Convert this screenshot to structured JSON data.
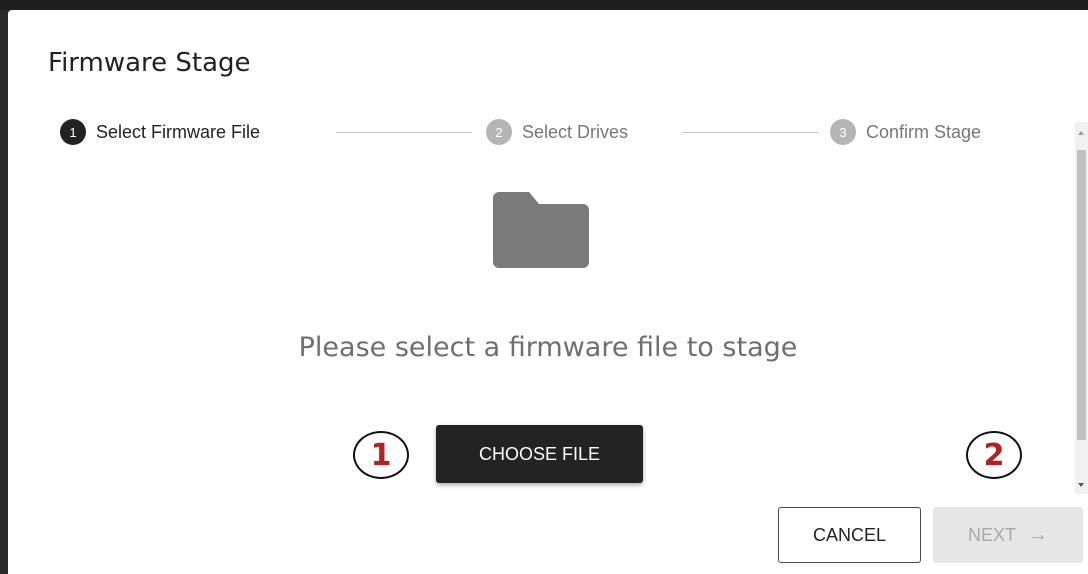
{
  "dialog": {
    "title": "Firmware Stage",
    "steps": [
      {
        "number": "1",
        "label": "Select Firmware File",
        "state": "active"
      },
      {
        "number": "2",
        "label": "Select Drives",
        "state": "inactive"
      },
      {
        "number": "3",
        "label": "Confirm Stage",
        "state": "inactive"
      }
    ],
    "empty_state": {
      "icon": "folder-icon",
      "message": "Please select a firmware file to stage"
    },
    "choose_file_label": "CHOOSE FILE",
    "annotations": [
      "1",
      "2"
    ],
    "actions": {
      "cancel_label": "CANCEL",
      "next_label": "NEXT",
      "next_icon": "arrow-right-icon"
    }
  },
  "colors": {
    "primary": "#232323",
    "inactive_step": "#b5b5b5",
    "annotation_text": "#b22222"
  }
}
